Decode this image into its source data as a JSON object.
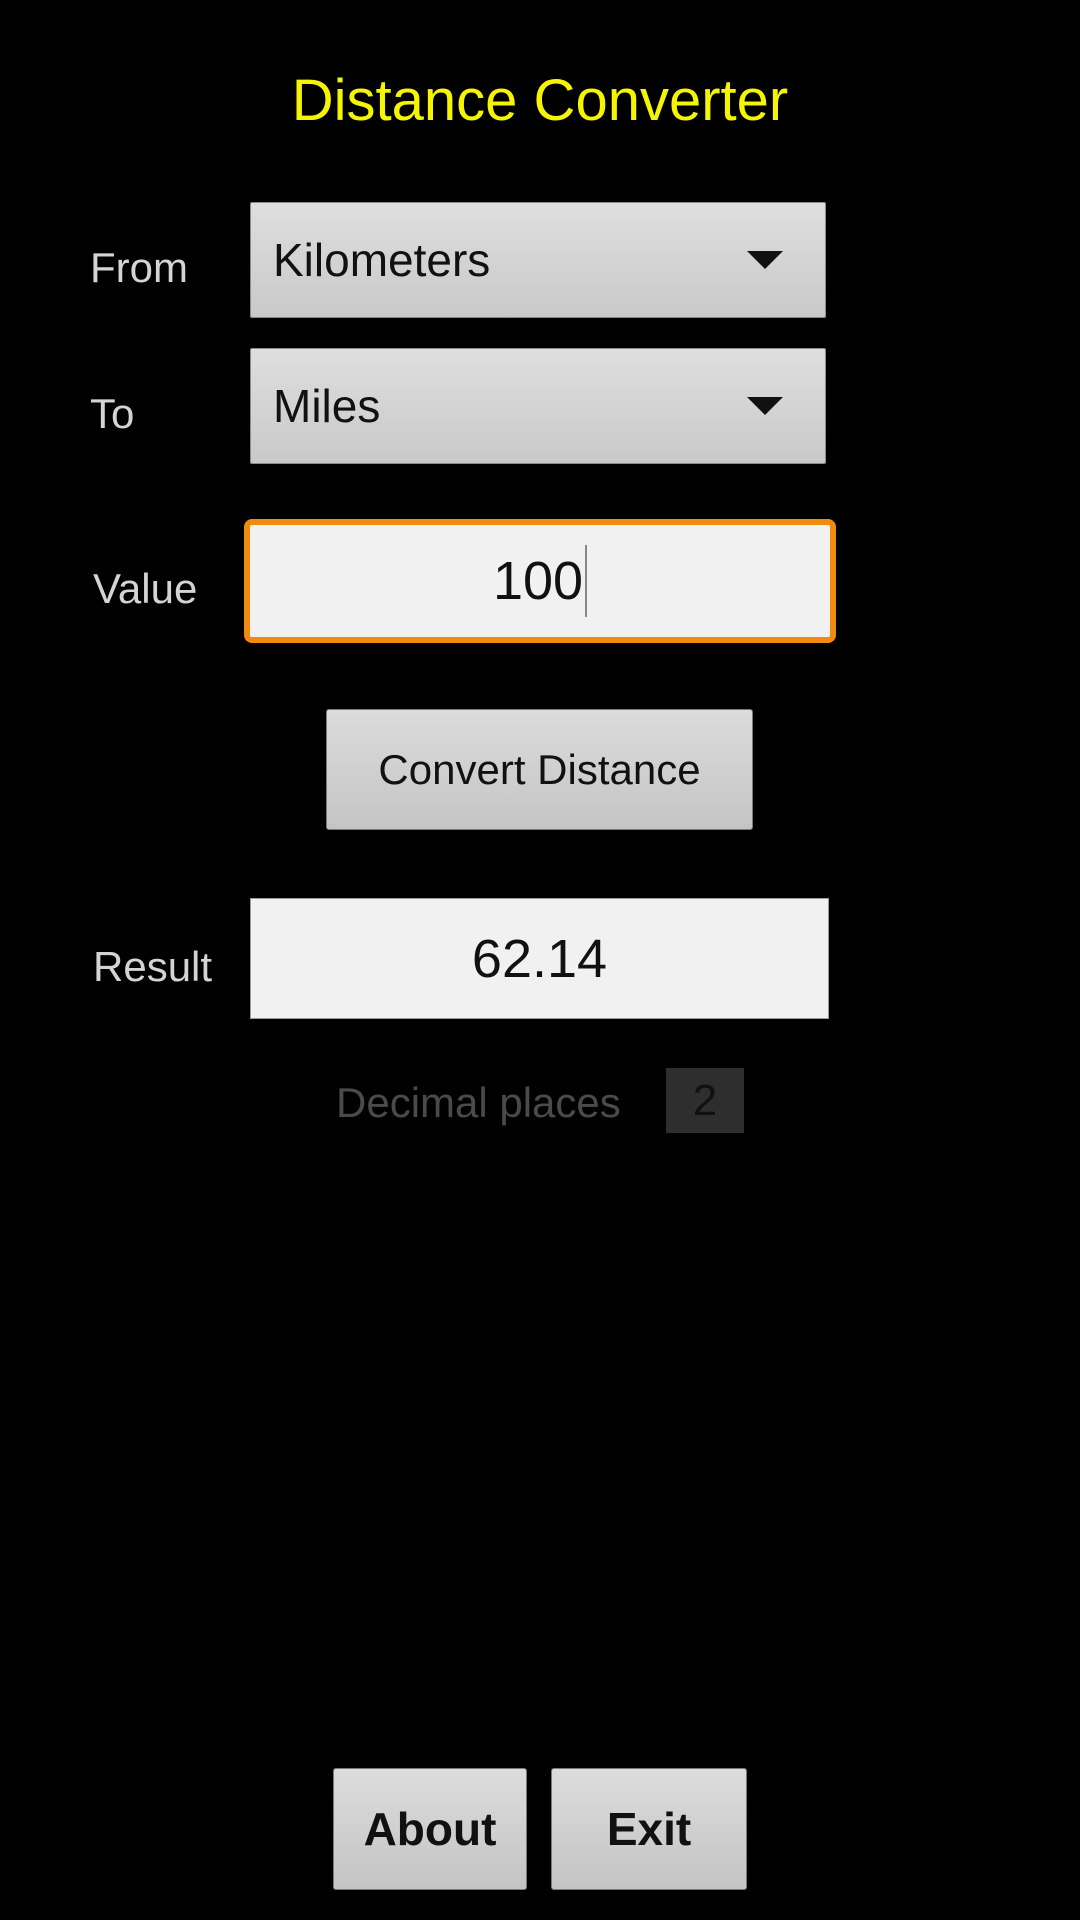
{
  "app": {
    "title": "Distance Converter"
  },
  "colors": {
    "title": "#f5f500",
    "focus_border": "#f08a10",
    "background": "#000000"
  },
  "form": {
    "from": {
      "label": "From",
      "value": "Kilometers",
      "icon": "dropdown-arrow-icon"
    },
    "to": {
      "label": "To",
      "value": "Miles",
      "icon": "dropdown-arrow-icon"
    },
    "value": {
      "label": "Value",
      "value": "100"
    },
    "convert_button": "Convert Distance",
    "result": {
      "label": "Result",
      "value": "62.14"
    },
    "decimal_places": {
      "label": "Decimal places",
      "value": "2"
    }
  },
  "footer": {
    "about_button": "About",
    "exit_button": "Exit"
  }
}
